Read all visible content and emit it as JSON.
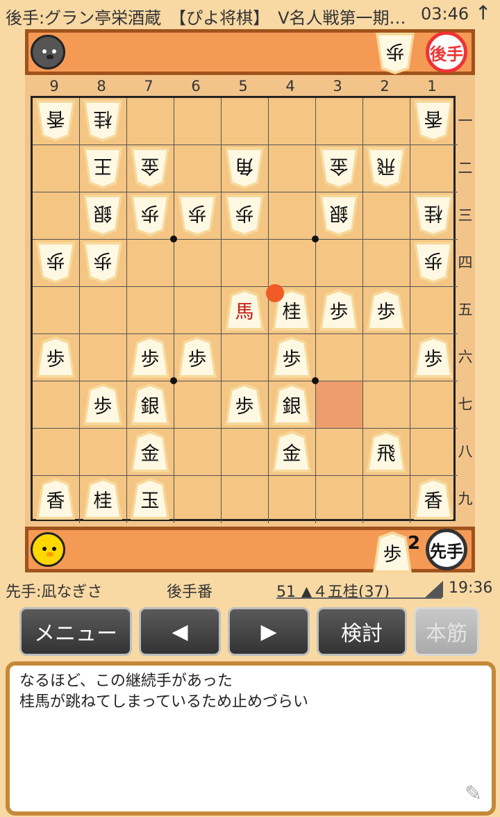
{
  "top_bar": {
    "title": "後手:グラン亭栄酒蔵　【ぴよ将棋】　V名人戦第一期…",
    "time": "03:46",
    "arrow_icon": "up-arrow-icon"
  },
  "gote_hand": {
    "avatar": "gray-chick-avatar",
    "badge": "後手",
    "pieces": [
      {
        "char": "歩",
        "count": ""
      }
    ]
  },
  "sente_hand": {
    "avatar": "yellow-chick-avatar",
    "badge": "先手",
    "pieces": [
      {
        "char": "歩",
        "count": "2"
      }
    ]
  },
  "board": {
    "files": [
      "9",
      "8",
      "7",
      "6",
      "5",
      "4",
      "3",
      "2",
      "1"
    ],
    "ranks": [
      "一",
      "二",
      "三",
      "四",
      "五",
      "六",
      "七",
      "八",
      "九"
    ],
    "highlight_square": [
      3,
      7
    ],
    "last_move_square": [
      4,
      5
    ],
    "pieces": [
      {
        "file": 9,
        "rank": 1,
        "char": "香",
        "side": "gote"
      },
      {
        "file": 8,
        "rank": 1,
        "char": "桂",
        "side": "gote"
      },
      {
        "file": 1,
        "rank": 1,
        "char": "香",
        "side": "gote"
      },
      {
        "file": 8,
        "rank": 2,
        "char": "王",
        "side": "gote"
      },
      {
        "file": 7,
        "rank": 2,
        "char": "金",
        "side": "gote"
      },
      {
        "file": 5,
        "rank": 2,
        "char": "角",
        "side": "gote"
      },
      {
        "file": 3,
        "rank": 2,
        "char": "金",
        "side": "gote"
      },
      {
        "file": 2,
        "rank": 2,
        "char": "飛",
        "side": "gote"
      },
      {
        "file": 8,
        "rank": 3,
        "char": "銀",
        "side": "gote"
      },
      {
        "file": 7,
        "rank": 3,
        "char": "歩",
        "side": "gote"
      },
      {
        "file": 6,
        "rank": 3,
        "char": "歩",
        "side": "gote"
      },
      {
        "file": 5,
        "rank": 3,
        "char": "歩",
        "side": "gote"
      },
      {
        "file": 3,
        "rank": 3,
        "char": "銀",
        "side": "gote"
      },
      {
        "file": 1,
        "rank": 3,
        "char": "桂",
        "side": "gote"
      },
      {
        "file": 9,
        "rank": 4,
        "char": "歩",
        "side": "gote"
      },
      {
        "file": 8,
        "rank": 4,
        "char": "歩",
        "side": "gote"
      },
      {
        "file": 1,
        "rank": 4,
        "char": "歩",
        "side": "gote"
      },
      {
        "file": 5,
        "rank": 5,
        "char": "馬",
        "side": "sente",
        "red": true
      },
      {
        "file": 4,
        "rank": 5,
        "char": "桂",
        "side": "sente"
      },
      {
        "file": 3,
        "rank": 5,
        "char": "歩",
        "side": "sente"
      },
      {
        "file": 2,
        "rank": 5,
        "char": "歩",
        "side": "sente"
      },
      {
        "file": 9,
        "rank": 6,
        "char": "歩",
        "side": "sente"
      },
      {
        "file": 7,
        "rank": 6,
        "char": "歩",
        "side": "sente"
      },
      {
        "file": 6,
        "rank": 6,
        "char": "歩",
        "side": "sente"
      },
      {
        "file": 4,
        "rank": 6,
        "char": "歩",
        "side": "sente"
      },
      {
        "file": 1,
        "rank": 6,
        "char": "歩",
        "side": "sente"
      },
      {
        "file": 8,
        "rank": 7,
        "char": "歩",
        "side": "sente"
      },
      {
        "file": 7,
        "rank": 7,
        "char": "銀",
        "side": "sente"
      },
      {
        "file": 5,
        "rank": 7,
        "char": "歩",
        "side": "sente"
      },
      {
        "file": 4,
        "rank": 7,
        "char": "銀",
        "side": "sente"
      },
      {
        "file": 7,
        "rank": 8,
        "char": "金",
        "side": "sente"
      },
      {
        "file": 4,
        "rank": 8,
        "char": "金",
        "side": "sente"
      },
      {
        "file": 2,
        "rank": 8,
        "char": "飛",
        "side": "sente"
      },
      {
        "file": 9,
        "rank": 9,
        "char": "香",
        "side": "sente"
      },
      {
        "file": 8,
        "rank": 9,
        "char": "桂",
        "side": "sente"
      },
      {
        "file": 7,
        "rank": 9,
        "char": "玉",
        "side": "sente"
      },
      {
        "file": 1,
        "rank": 9,
        "char": "香",
        "side": "sente"
      }
    ]
  },
  "status": {
    "sente_player": "先手:凪なぎさ",
    "turn": "後手番",
    "move": "51 ▲４五桂(37)",
    "clock": "19:36"
  },
  "buttons": {
    "menu": "メニュー",
    "prev": "◀",
    "next": "▶",
    "analyze": "検討",
    "mainline": "本筋"
  },
  "comment": {
    "lines": [
      "なるほど、この継続手があった",
      "桂馬が跳ねてしまっているため止めづらい"
    ],
    "edit_icon": "pencil-icon"
  }
}
